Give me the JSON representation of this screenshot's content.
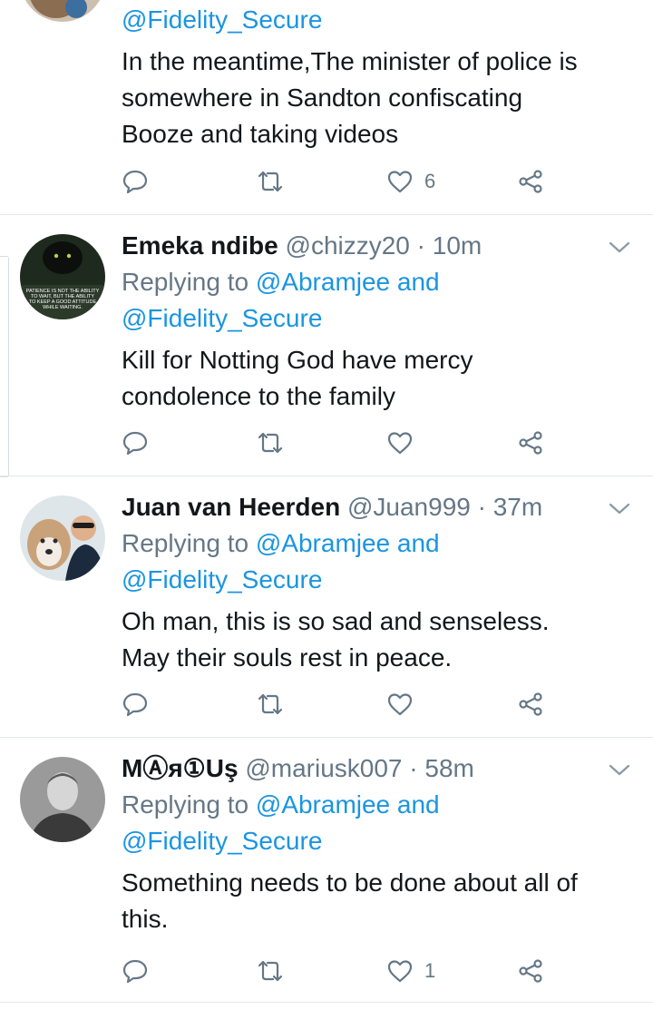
{
  "tweets": [
    {
      "reply_line_end": "@Fidelity_Secure",
      "text_lines": [
        "In the meantime,The minister of police is",
        "somewhere in Sandton confiscating",
        "Booze and taking videos"
      ],
      "likes": "6"
    },
    {
      "name": "Emeka ndibe",
      "meta": "@chizzy20 · 10m",
      "replying_prefix": "Replying to ",
      "replying_1": "@Abramjee and",
      "replying_2": "@Fidelity_Secure",
      "text_lines": [
        "Kill for Notting God have mercy",
        "condolence to the family"
      ],
      "avatar_text": [
        "PATIENCE IS NOT THE ABILITY",
        "TO WAIT, BUT THE ABILITY",
        "TO KEEP A GOOD ATTITUDE",
        "WHILE WAITING."
      ],
      "likes": ""
    },
    {
      "name": "Juan van Heerden",
      "meta": "@Juan999 · 37m",
      "replying_prefix": "Replying to ",
      "replying_1": "@Abramjee and",
      "replying_2": "@Fidelity_Secure",
      "text_lines": [
        "Oh man, this is so sad and senseless.",
        "May their souls rest in peace."
      ],
      "likes": ""
    },
    {
      "name": "MⒶя①Uş",
      "meta": "@mariusk007 · 58m",
      "replying_prefix": "Replying to ",
      "replying_1": "@Abramjee and",
      "replying_2": "@Fidelity_Secure",
      "text_lines": [
        "Something needs to be done about all of",
        "this."
      ],
      "likes": "1"
    }
  ],
  "icons": {
    "reply": "reply-icon",
    "retweet": "retweet-icon",
    "like": "heart-icon",
    "share": "share-icon",
    "caret": "chevron-down-icon"
  },
  "colors": {
    "link": "#1b95e0",
    "secondary": "#657786",
    "text": "#14171a",
    "divider": "#e1e8ed"
  }
}
